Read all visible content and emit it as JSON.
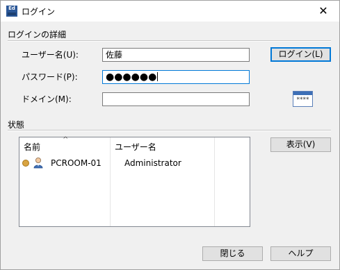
{
  "window": {
    "title": "ログイン",
    "app_icon_text": "Ed",
    "close_glyph": "✕"
  },
  "login_details": {
    "section_title": "ログインの詳細",
    "username_label": "ユーザー名(U):",
    "username_value": "佐藤",
    "password_label": "パスワード(P):",
    "password_dots": "●●●●●●",
    "domain_label": "ドメイン(M):",
    "domain_value": "",
    "login_button": "ログイン(L)",
    "keypad_icon_text": "****"
  },
  "status": {
    "section_title": "状態",
    "columns": [
      "名前",
      "ユーザー名"
    ],
    "sort_indicator": "^",
    "rows": [
      {
        "name": "PCROOM-01",
        "username": "Administrator",
        "status_color": "#d9a441"
      }
    ],
    "show_button": "表示(V)"
  },
  "footer": {
    "close_button": "閉じる",
    "help_button": "ヘルプ"
  }
}
